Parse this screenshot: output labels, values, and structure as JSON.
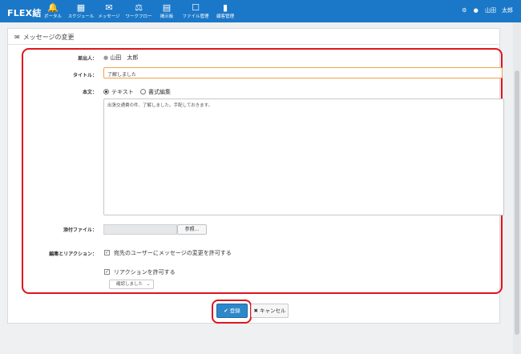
{
  "app": {
    "logo": "FLEX結",
    "user_name": "山田　太郎"
  },
  "nav": {
    "items": [
      {
        "label": "ポータル",
        "icon": "bell-icon",
        "glyph": "🔔"
      },
      {
        "label": "スケジュール",
        "icon": "calendar-icon",
        "glyph": "▦"
      },
      {
        "label": "メッセージ",
        "icon": "envelope-icon",
        "glyph": "✉"
      },
      {
        "label": "ワークフロー",
        "icon": "workflow-icon",
        "glyph": "⚖"
      },
      {
        "label": "掲示板",
        "icon": "bulletin-board-icon",
        "glyph": "▤"
      },
      {
        "label": "ファイル管理",
        "icon": "drive-icon",
        "glyph": "☐"
      },
      {
        "label": "顧客管理",
        "icon": "customer-icon",
        "glyph": "▮"
      }
    ]
  },
  "page": {
    "title": "メッセージの変更"
  },
  "form": {
    "sender_label": "差出人：",
    "sender_value": "山田　太郎",
    "title_label": "タイトル：",
    "title_value": "了解しました",
    "body_label": "本文：",
    "body_mode_text": "テキスト",
    "body_mode_rich": "書式編集",
    "body_text": "出張交通費の件、了解しました。手配しておきます。",
    "attachment_label": "添付ファイル：",
    "browse_button": "参照...",
    "edit_reaction_label": "編集とリアクション：",
    "allow_edit_label": "宛先のユーザーにメッセージの変更を許可する",
    "allow_reaction_label": "リアクションを許可する",
    "reaction_select_value": "確認しました"
  },
  "footer": {
    "register_button": "登録",
    "cancel_button": "キャンセル"
  }
}
